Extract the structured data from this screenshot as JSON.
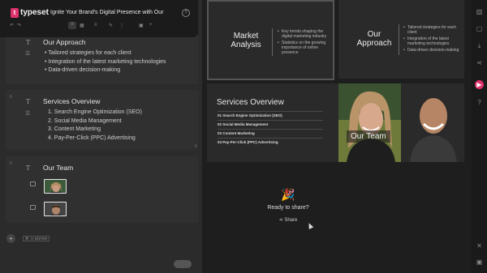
{
  "app": {
    "logo_letter": "t",
    "brand": "typeset",
    "doc_title": "Ignite Your Brand's Digital Presence with Our",
    "help": "?"
  },
  "toolbar": {
    "undo": "↶",
    "redo": "↷",
    "align": "≡",
    "layout": "▦",
    "pen": "✎",
    "divider": "⋮",
    "image": "▣",
    "more": "+"
  },
  "editor": {
    "cards": [
      {
        "number": "",
        "heading": "Our Approach",
        "bullets": [
          "Tailored strategies for each client",
          "Integration of the latest marketing technologies",
          "Data-driven decision-making"
        ]
      },
      {
        "number": "5",
        "heading": "Services Overview",
        "items": [
          "1. Search Engine Optimization (SEO)",
          "2. Social Media Management",
          "3. Content Marketing",
          "4. Pay-Per-Click (PPC) Advertising"
        ]
      },
      {
        "number": "6",
        "heading": "Our Team"
      }
    ],
    "add": "+",
    "shortcut_key1": "⌘",
    "shortcut_key2": "ENTER"
  },
  "canvas": {
    "slide_market": {
      "title": "Market Analysis",
      "bullets": [
        "Key trends shaping the digital marketing industry",
        "Statistics on the growing importance of online presence"
      ]
    },
    "slide_approach": {
      "title": "Our Approach",
      "bullets": [
        "Tailored strategies for each client",
        "Integration of the latest marketing technologies",
        "Data-driven decision-making"
      ]
    },
    "slide_services": {
      "title": "Services Overview",
      "rows": [
        "01  Search Engine Optimization (SEO)",
        "02  Social Media Management",
        "03  Content Marketing",
        "04  Pay-Per-Click (PPC) Advertising"
      ]
    },
    "slide_team": {
      "label": "Our Team"
    },
    "share": {
      "emoji": "🎉",
      "question": "Ready to share?",
      "button": "Share"
    }
  },
  "rail": {
    "icons": [
      "layout-icon",
      "image-icon",
      "download-icon",
      "share-icon",
      "play-icon",
      "help-icon",
      "twitter-icon",
      "linkedin-icon"
    ]
  },
  "colors": {
    "accent": "#e0316b",
    "bg": "#1c1c1c",
    "panel": "#2b2b2b"
  }
}
